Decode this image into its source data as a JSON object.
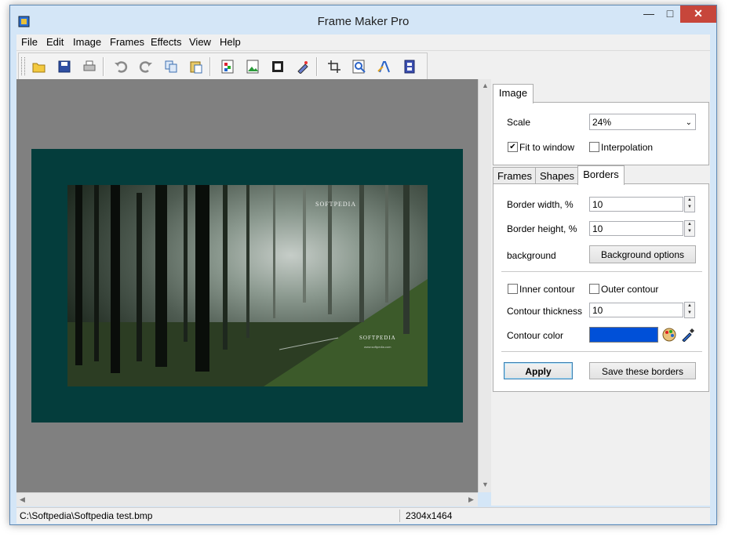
{
  "window": {
    "title": "Frame Maker Pro"
  },
  "menu": [
    "File",
    "Edit",
    "Image",
    "Frames",
    "Effects",
    "View",
    "Help"
  ],
  "toolbar": {
    "buttons": [
      "open-icon",
      "save-icon",
      "print-icon",
      "undo-icon",
      "redo-icon",
      "copy-icon",
      "paste-icon",
      "frame-icon",
      "image-icon",
      "border-icon",
      "effects-icon",
      "crop-icon",
      "zoom-icon",
      "text-icon",
      "film-icon"
    ]
  },
  "photo": {
    "watermark_top": "SOFTPEDIA",
    "watermark_bottom": "SOFTPEDIA",
    "watermark_small": "www.softpedia.com"
  },
  "panel": {
    "image_tab": "Image",
    "scale_label": "Scale",
    "scale_value": "24%",
    "fit_to_window_label": "Fit to window",
    "fit_to_window_checked": true,
    "interpolation_label": "Interpolation",
    "interpolation_checked": false,
    "tabs": [
      "Frames",
      "Shapes",
      "Borders"
    ],
    "active_tab": "Borders",
    "border_width_label": "Border width, %",
    "border_width_value": "10",
    "border_height_label": "Border height, %",
    "border_height_value": "10",
    "background_label": "background",
    "background_button": "Background options",
    "inner_contour_label": "Inner contour",
    "outer_contour_label": "Outer contour",
    "contour_thickness_label": "Contour thickness",
    "contour_thickness_value": "10",
    "contour_color_label": "Contour color",
    "contour_color": "#0050d8",
    "apply_button": "Apply",
    "save_button": "Save these borders"
  },
  "colors": {
    "frame_border": "#043d3c",
    "canvas_bg": "#808080"
  },
  "status": {
    "path": "C:\\Softpedia\\Softpedia test.bmp",
    "dimensions": "2304x1464"
  }
}
